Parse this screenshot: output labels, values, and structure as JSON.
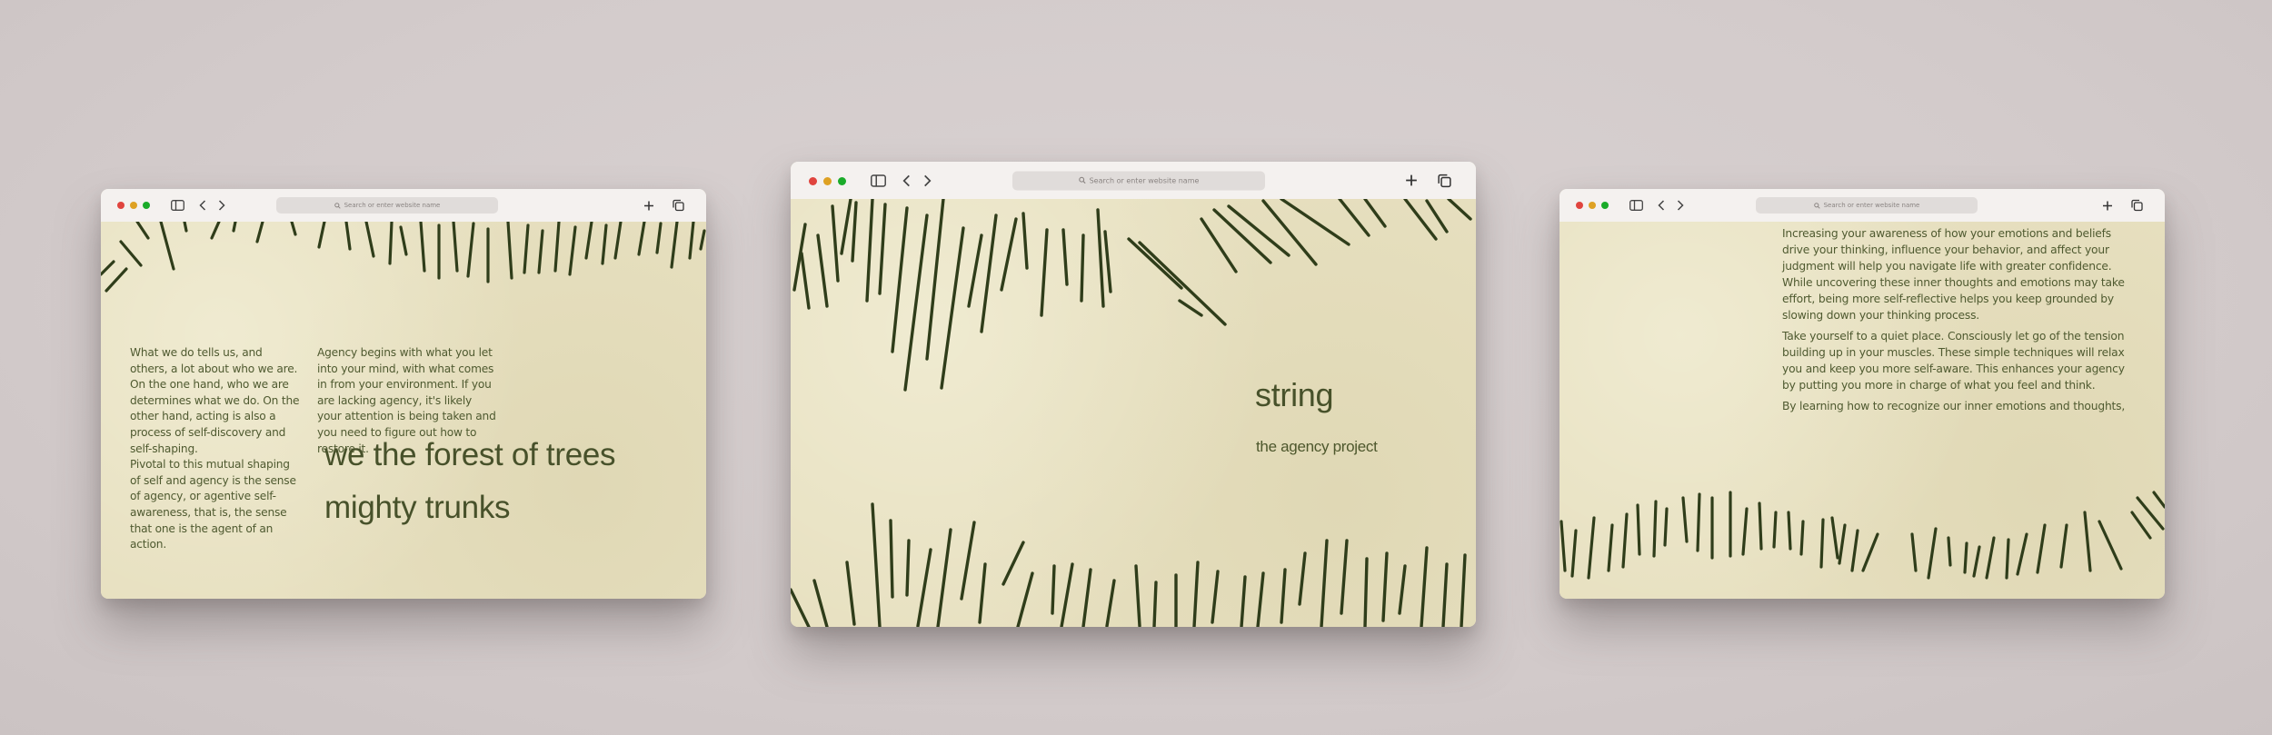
{
  "browser": {
    "address_placeholder": "Search or enter website name",
    "traffic_lights": [
      "#e0443e",
      "#dea123",
      "#1aab29"
    ]
  },
  "colors": {
    "paper": "#e7e0c0",
    "thread": "#2f3d1a",
    "text": "#4f5a30"
  },
  "left_window": {
    "col1": "What we do tells us, and others, a lot about who we are. On the one hand, who we are determines what we do. On the other hand, acting is also a process of self-discovery and self-shaping.\nPivotal to this mutual shaping of self and agency is the sense of agency, or agentive self-awareness, that is, the sense that one is the agent of an action.",
    "col2": "Agency begins with what you let into your mind, with what comes in from your environment. If you are lacking agency, it's likely your attention is being taken and you need to figure out how to restore it.",
    "headline1": "we the forest of trees",
    "headline2": "mighty trunks"
  },
  "center_window": {
    "title": "string",
    "subtitle": "the agency project"
  },
  "right_window": {
    "paragraphs": [
      "Increasing your awareness of how your emotions and beliefs drive your thinking, influence your behavior, and affect your judgment will help you navigate life with greater confidence. While uncovering these inner thoughts and emotions may take effort, being more self-reflective helps you keep grounded by slowing down your thinking process.",
      "Take yourself to a quiet place. Consciously let go of the tension building up in your muscles. These simple techniques will relax you and keep you more self-aware. This enhances your agency by putting you more in charge of what you feel and think.",
      "By learning how to recognize our inner emotions and thoughts,"
    ]
  },
  "icons": [
    "sidebar-icon",
    "back-icon",
    "forward-icon",
    "search-icon",
    "new-tab-icon",
    "tabs-overview-icon"
  ]
}
